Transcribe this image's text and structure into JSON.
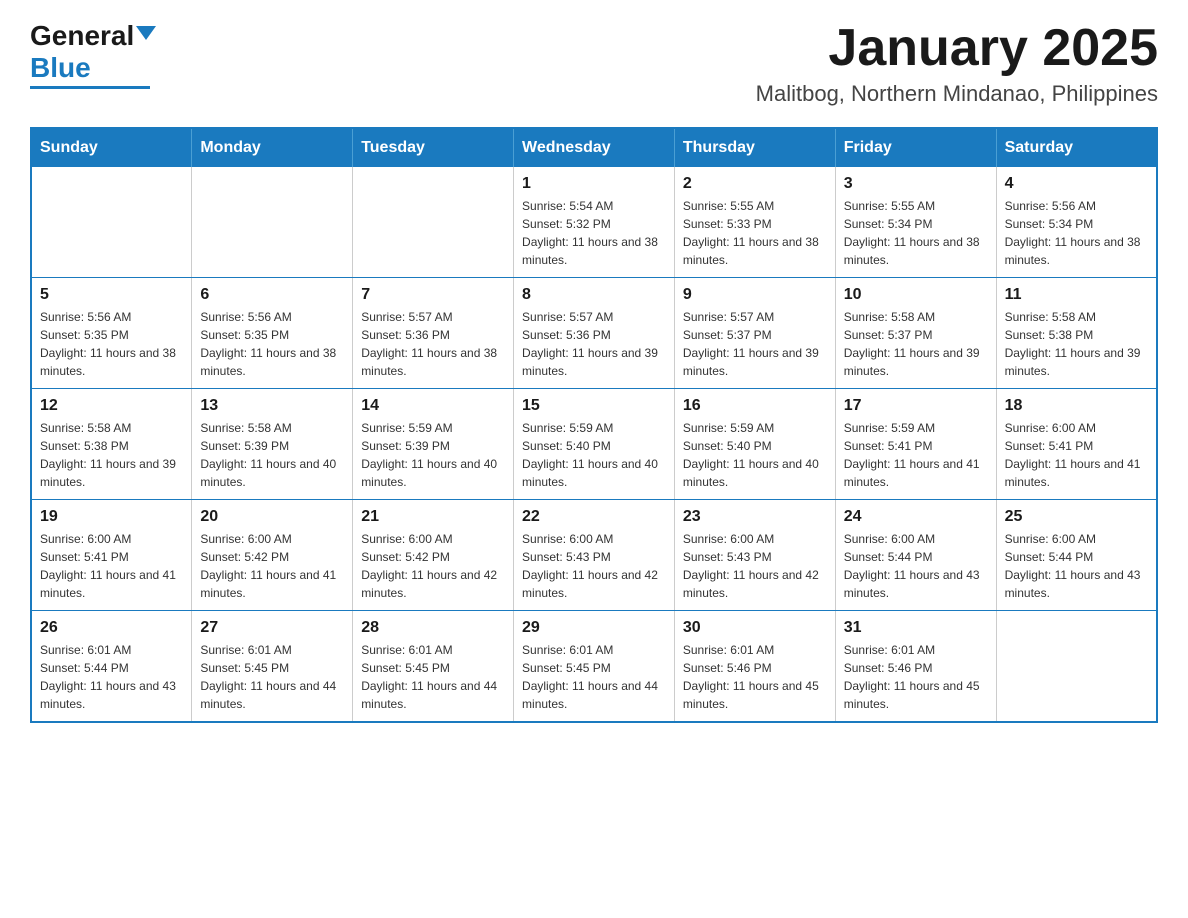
{
  "logo": {
    "general": "General",
    "blue": "Blue"
  },
  "header": {
    "month": "January 2025",
    "location": "Malitbog, Northern Mindanao, Philippines"
  },
  "weekdays": [
    "Sunday",
    "Monday",
    "Tuesday",
    "Wednesday",
    "Thursday",
    "Friday",
    "Saturday"
  ],
  "weeks": [
    [
      {
        "day": "",
        "info": ""
      },
      {
        "day": "",
        "info": ""
      },
      {
        "day": "",
        "info": ""
      },
      {
        "day": "1",
        "info": "Sunrise: 5:54 AM\nSunset: 5:32 PM\nDaylight: 11 hours and 38 minutes."
      },
      {
        "day": "2",
        "info": "Sunrise: 5:55 AM\nSunset: 5:33 PM\nDaylight: 11 hours and 38 minutes."
      },
      {
        "day": "3",
        "info": "Sunrise: 5:55 AM\nSunset: 5:34 PM\nDaylight: 11 hours and 38 minutes."
      },
      {
        "day": "4",
        "info": "Sunrise: 5:56 AM\nSunset: 5:34 PM\nDaylight: 11 hours and 38 minutes."
      }
    ],
    [
      {
        "day": "5",
        "info": "Sunrise: 5:56 AM\nSunset: 5:35 PM\nDaylight: 11 hours and 38 minutes."
      },
      {
        "day": "6",
        "info": "Sunrise: 5:56 AM\nSunset: 5:35 PM\nDaylight: 11 hours and 38 minutes."
      },
      {
        "day": "7",
        "info": "Sunrise: 5:57 AM\nSunset: 5:36 PM\nDaylight: 11 hours and 38 minutes."
      },
      {
        "day": "8",
        "info": "Sunrise: 5:57 AM\nSunset: 5:36 PM\nDaylight: 11 hours and 39 minutes."
      },
      {
        "day": "9",
        "info": "Sunrise: 5:57 AM\nSunset: 5:37 PM\nDaylight: 11 hours and 39 minutes."
      },
      {
        "day": "10",
        "info": "Sunrise: 5:58 AM\nSunset: 5:37 PM\nDaylight: 11 hours and 39 minutes."
      },
      {
        "day": "11",
        "info": "Sunrise: 5:58 AM\nSunset: 5:38 PM\nDaylight: 11 hours and 39 minutes."
      }
    ],
    [
      {
        "day": "12",
        "info": "Sunrise: 5:58 AM\nSunset: 5:38 PM\nDaylight: 11 hours and 39 minutes."
      },
      {
        "day": "13",
        "info": "Sunrise: 5:58 AM\nSunset: 5:39 PM\nDaylight: 11 hours and 40 minutes."
      },
      {
        "day": "14",
        "info": "Sunrise: 5:59 AM\nSunset: 5:39 PM\nDaylight: 11 hours and 40 minutes."
      },
      {
        "day": "15",
        "info": "Sunrise: 5:59 AM\nSunset: 5:40 PM\nDaylight: 11 hours and 40 minutes."
      },
      {
        "day": "16",
        "info": "Sunrise: 5:59 AM\nSunset: 5:40 PM\nDaylight: 11 hours and 40 minutes."
      },
      {
        "day": "17",
        "info": "Sunrise: 5:59 AM\nSunset: 5:41 PM\nDaylight: 11 hours and 41 minutes."
      },
      {
        "day": "18",
        "info": "Sunrise: 6:00 AM\nSunset: 5:41 PM\nDaylight: 11 hours and 41 minutes."
      }
    ],
    [
      {
        "day": "19",
        "info": "Sunrise: 6:00 AM\nSunset: 5:41 PM\nDaylight: 11 hours and 41 minutes."
      },
      {
        "day": "20",
        "info": "Sunrise: 6:00 AM\nSunset: 5:42 PM\nDaylight: 11 hours and 41 minutes."
      },
      {
        "day": "21",
        "info": "Sunrise: 6:00 AM\nSunset: 5:42 PM\nDaylight: 11 hours and 42 minutes."
      },
      {
        "day": "22",
        "info": "Sunrise: 6:00 AM\nSunset: 5:43 PM\nDaylight: 11 hours and 42 minutes."
      },
      {
        "day": "23",
        "info": "Sunrise: 6:00 AM\nSunset: 5:43 PM\nDaylight: 11 hours and 42 minutes."
      },
      {
        "day": "24",
        "info": "Sunrise: 6:00 AM\nSunset: 5:44 PM\nDaylight: 11 hours and 43 minutes."
      },
      {
        "day": "25",
        "info": "Sunrise: 6:00 AM\nSunset: 5:44 PM\nDaylight: 11 hours and 43 minutes."
      }
    ],
    [
      {
        "day": "26",
        "info": "Sunrise: 6:01 AM\nSunset: 5:44 PM\nDaylight: 11 hours and 43 minutes."
      },
      {
        "day": "27",
        "info": "Sunrise: 6:01 AM\nSunset: 5:45 PM\nDaylight: 11 hours and 44 minutes."
      },
      {
        "day": "28",
        "info": "Sunrise: 6:01 AM\nSunset: 5:45 PM\nDaylight: 11 hours and 44 minutes."
      },
      {
        "day": "29",
        "info": "Sunrise: 6:01 AM\nSunset: 5:45 PM\nDaylight: 11 hours and 44 minutes."
      },
      {
        "day": "30",
        "info": "Sunrise: 6:01 AM\nSunset: 5:46 PM\nDaylight: 11 hours and 45 minutes."
      },
      {
        "day": "31",
        "info": "Sunrise: 6:01 AM\nSunset: 5:46 PM\nDaylight: 11 hours and 45 minutes."
      },
      {
        "day": "",
        "info": ""
      }
    ]
  ]
}
